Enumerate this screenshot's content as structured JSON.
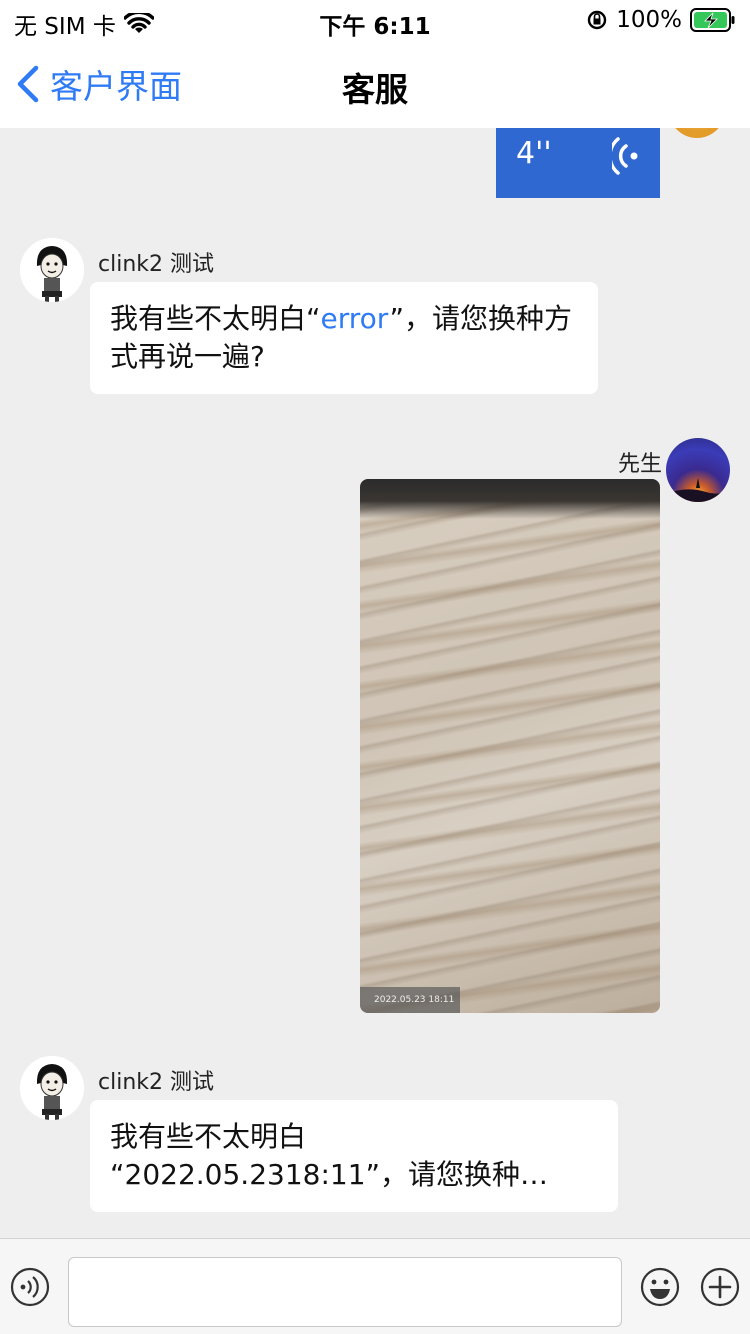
{
  "status_bar": {
    "carrier": "无 SIM 卡",
    "time": "下午 6:11",
    "battery": "100%"
  },
  "nav": {
    "back_label": "客户界面",
    "title": "客服"
  },
  "messages": {
    "voice": {
      "duration": "4''"
    },
    "agent_1": {
      "name": "clink2 测试",
      "text_before": "我有些不太明白“",
      "highlight": "error",
      "text_after": "”，请您换种方式再说一遍?"
    },
    "user_image": {
      "name": "先生",
      "timestamp": "2022.05.23 18:11"
    },
    "agent_2": {
      "name": "clink2 测试",
      "line1": "我有些不太明白",
      "line2": "“2022.05.2318:11”，请您换种…"
    }
  },
  "input": {
    "value": "",
    "placeholder": ""
  },
  "colors": {
    "accent": "#2f7bf5",
    "voice_bubble": "#3068d1",
    "background": "#efeeef"
  }
}
